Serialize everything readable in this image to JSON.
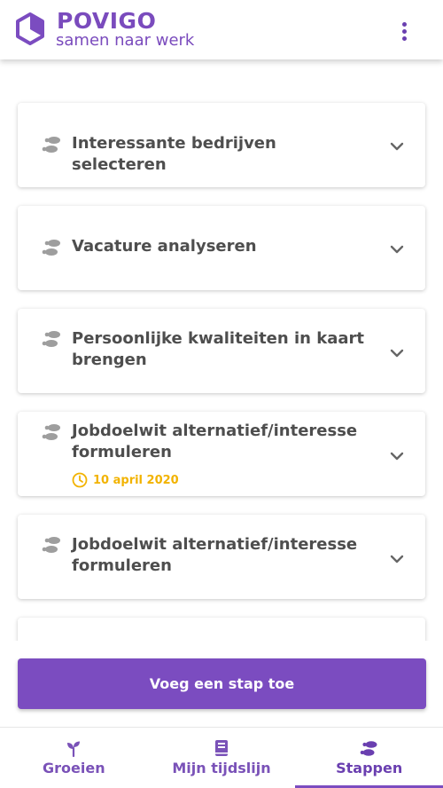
{
  "header": {
    "brand": "POVIGO",
    "tagline": "samen naar werk",
    "logo_icon": "hexagon-logo-icon",
    "menu_icon": "more-vertical-icon"
  },
  "steps": [
    {
      "title": "Interessante bedrijven selecteren",
      "icon": "footsteps-icon",
      "expand_icon": "chevron-down-icon"
    },
    {
      "title": "Vacature analyseren",
      "icon": "footsteps-icon",
      "expand_icon": "chevron-down-icon"
    },
    {
      "title": "Persoonlijke kwaliteiten in kaart brengen",
      "icon": "footsteps-icon",
      "expand_icon": "chevron-down-icon"
    },
    {
      "title": "Jobdoelwit alternatief/interesse formuleren",
      "date": "10 april 2020",
      "date_icon": "clock-icon",
      "icon": "footsteps-icon",
      "expand_icon": "chevron-down-icon"
    },
    {
      "title": "Jobdoelwit alternatief/interesse formuleren",
      "icon": "footsteps-icon",
      "expand_icon": "chevron-down-icon"
    }
  ],
  "actions": {
    "add_step_label": "Voeg een stap toe"
  },
  "nav": {
    "tabs": [
      {
        "label": "Groeien",
        "icon": "sprout-icon",
        "active": false
      },
      {
        "label": "Mijn tijdslijn",
        "icon": "book-icon",
        "active": false
      },
      {
        "label": "Stappen",
        "icon": "footsteps-icon",
        "active": true
      }
    ]
  },
  "colors": {
    "brand": "#7b4cc0",
    "date_accent": "#f2b300",
    "text": "#4e4e4e",
    "icon_gray": "#9e9e9e"
  }
}
